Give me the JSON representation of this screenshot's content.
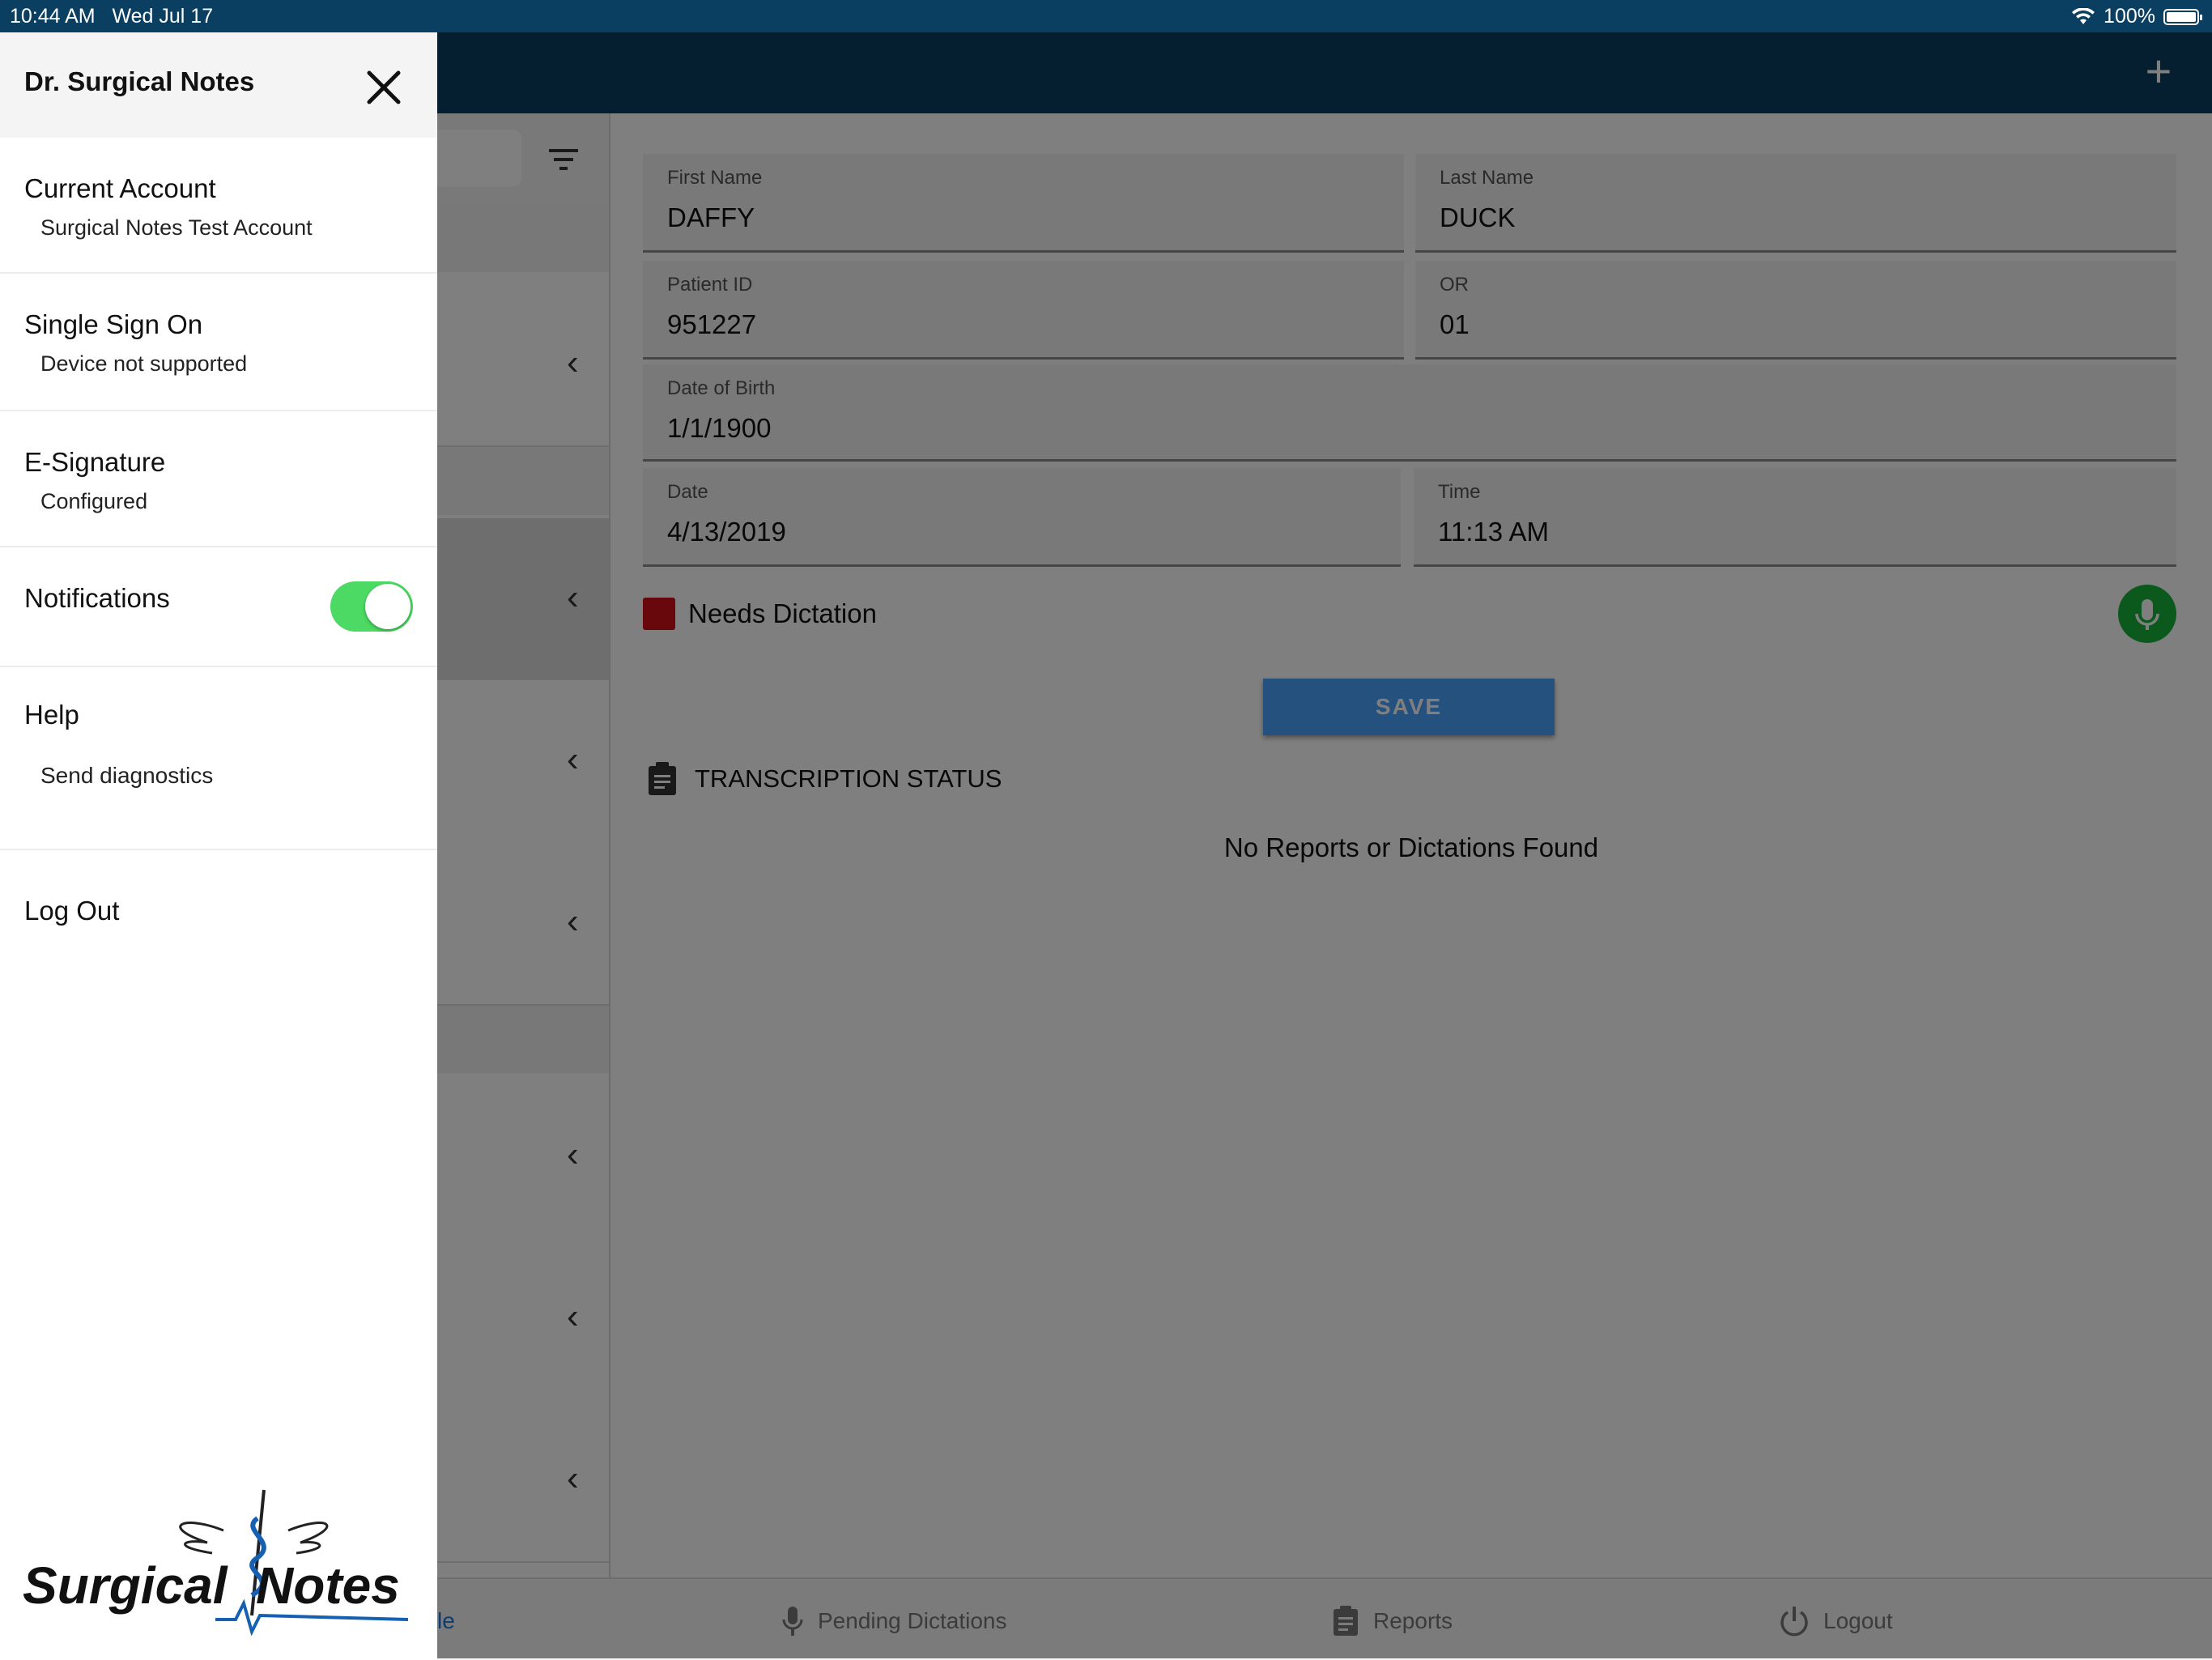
{
  "status_bar": {
    "time": "10:44 AM",
    "date": "Wed Jul 17",
    "battery": "100%"
  },
  "app_bar": {
    "add_icon": "plus-icon"
  },
  "form": {
    "first_name": {
      "label": "First Name",
      "value": "DAFFY"
    },
    "last_name": {
      "label": "Last Name",
      "value": "DUCK"
    },
    "patient_id": {
      "label": "Patient ID",
      "value": "951227"
    },
    "or": {
      "label": "OR",
      "value": "01"
    },
    "dob": {
      "label": "Date of Birth",
      "value": "1/1/1900"
    },
    "date": {
      "label": "Date",
      "value": "4/13/2019"
    },
    "time": {
      "label": "Time",
      "value": "11:13 AM"
    },
    "needs_dictation": "Needs Dictation",
    "save_label": "SAVE",
    "transcription_title": "TRANSCRIPTION STATUS",
    "empty_message": "No Reports or Dictations Found"
  },
  "tabbar": {
    "schedule_partial": "le",
    "pending": "Pending Dictations",
    "reports": "Reports",
    "logout": "Logout"
  },
  "drawer": {
    "title": "Dr. Surgical Notes",
    "current_account": {
      "title": "Current Account",
      "value": "Surgical Notes Test Account"
    },
    "sso": {
      "title": "Single Sign On",
      "value": "Device not supported"
    },
    "esig": {
      "title": "E-Signature",
      "value": "Configured"
    },
    "notifications": {
      "title": "Notifications",
      "enabled": true
    },
    "help": {
      "title": "Help",
      "link": "Send diagnostics"
    },
    "logout": "Log Out",
    "logo_text": "Surgical Notes"
  },
  "colors": {
    "app_bar": "#0a3f62",
    "toggle_on": "#4cd964",
    "save_button": "#4aa3ff",
    "mic_button": "#16b23a",
    "needs_dictation_box": "#d0101a",
    "link": "#1a7ae0"
  }
}
